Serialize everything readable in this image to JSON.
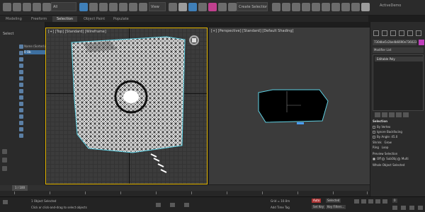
{
  "main_toolbar": {
    "selection_filter": "All",
    "selection_set_placeholder": "Create Selection Set",
    "workspace": "ActiveDemo",
    "view_dropdown": "View"
  },
  "ribbon_tabs": [
    "Modeling",
    "Freeform",
    "Selection",
    "Object Paint",
    "Populate"
  ],
  "ribbon_active_index": 2,
  "scene_explorer": {
    "title": "Select",
    "header": "Name (Sorted Ascending)",
    "rows": [
      "0 Ob",
      "",
      ""
    ],
    "frame_counter": "1 / 100"
  },
  "viewports": {
    "top_label": "[+] [Top] [Standard] [Wireframe]",
    "persp_label": "[+] [Perspective] [Standard] [Default Shading]"
  },
  "command_panel": {
    "object_name": "730dbe5c2be4b6690e7360238c8b0",
    "modifier_list": "Modifier List",
    "stack_item": "Editable Poly",
    "selection_title": "Selection",
    "by_vertex": "By Vertex",
    "ignore_backfacing": "Ignore Backfacing",
    "by_angle": "By Angle:",
    "by_angle_value": "45.0",
    "shrink": "Shrink",
    "grow": "Grow",
    "ring": "Ring",
    "loop": "Loop",
    "preview_selection": "Preview Selection",
    "preview_off": "Off",
    "preview_subobj": "SubObj",
    "preview_multi": "Multi",
    "whole_object": "Whole Object Selected",
    "colors": {
      "object_color": "#c03ebc",
      "selected_row": "#3d6fa0"
    }
  },
  "status": {
    "selected": "1 Object Selected",
    "prompt": "Click or click-and-drag to select objects",
    "grid": "Grid = 10.0m",
    "auto": "Auto",
    "set_key": "Set Key",
    "selected_dropdown": "Selected",
    "key_filters": "Key Filters...",
    "add_time_tag": "Add Time Tag",
    "frame": "0"
  },
  "timeline": {
    "tick_labels": [
      "0",
      "10",
      "20",
      "30",
      "40",
      "50",
      "60",
      "70",
      "80",
      "90",
      "100"
    ]
  },
  "icons": {
    "tb": "toolbar-icons",
    "nav": "view-cube-icon"
  }
}
